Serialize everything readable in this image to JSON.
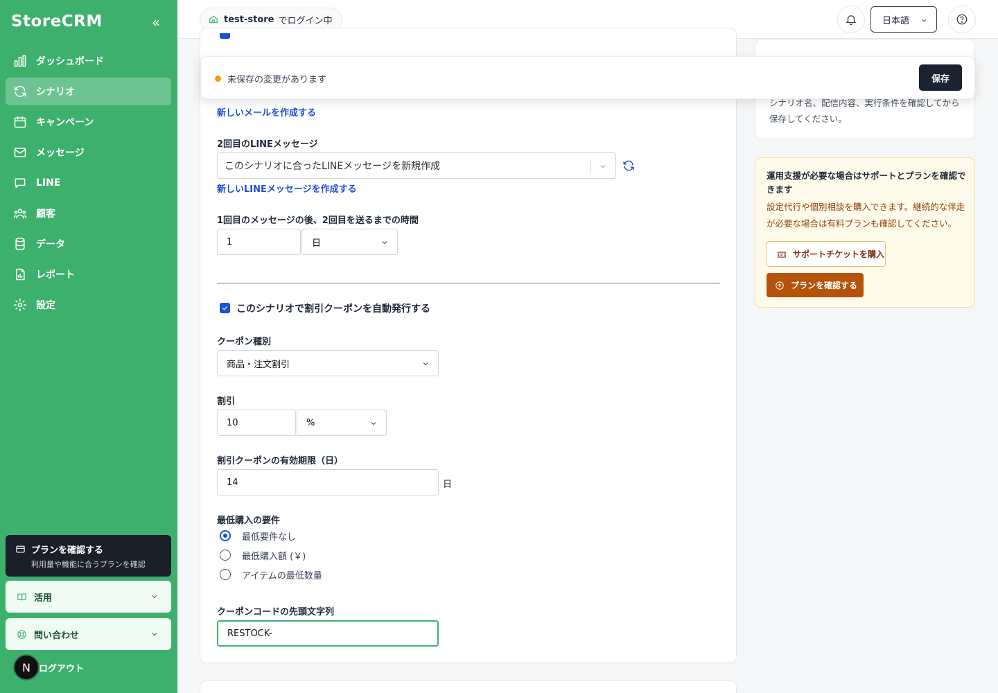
{
  "app": {
    "logo": "StoreCRM"
  },
  "sidebar": {
    "items": [
      {
        "label": "ダッシュボード",
        "icon": "chart-bar-icon"
      },
      {
        "label": "シナリオ",
        "icon": "refresh-cycle-icon",
        "active": true
      },
      {
        "label": "キャンペーン",
        "icon": "calendar-icon"
      },
      {
        "label": "メッセージ",
        "icon": "mail-icon"
      },
      {
        "label": "LINE",
        "icon": "chat-bubble-icon"
      },
      {
        "label": "顧客",
        "icon": "users-icon"
      },
      {
        "label": "データ",
        "icon": "database-icon"
      },
      {
        "label": "レポート",
        "icon": "report-file-icon"
      },
      {
        "label": "設定",
        "icon": "gear-icon"
      }
    ],
    "plan_card": {
      "title": "プランを確認する",
      "subtitle": "利用量や機能に合うプランを確認"
    },
    "usage": "活用",
    "contact": "問い合わせ",
    "logout": "ログアウト",
    "avatar_letter": "N"
  },
  "header": {
    "store_name": "test-store",
    "store_suffix": "でログイン中",
    "language": "日本語"
  },
  "unsaved_bar": {
    "message": "未保存の変更があります",
    "save_label": "保存"
  },
  "form": {
    "new_email_link": "新しいメールを作成する",
    "line2_label": "2回目のLINEメッセージ",
    "line2_value": "このシナリオに合ったLINEメッセージを新規作成",
    "new_line_link": "新しいLINEメッセージを作成する",
    "interval_label": "1回目のメッセージの後、2回目を送るまでの時間",
    "interval_value": "1",
    "interval_unit": "日",
    "coupon_checkbox_label": "このシナリオで割引クーポンを自動発行する",
    "coupon_type_label": "クーポン種別",
    "coupon_type_value": "商品・注文割引",
    "discount_label": "割引",
    "discount_value": "10",
    "discount_unit": "%",
    "expiry_label": "割引クーポンの有効期限（日）",
    "expiry_value": "14",
    "expiry_unit": "日",
    "min_req_label": "最低購入の要件",
    "min_req_options": [
      "最低要件なし",
      "最低購入額 (￥)",
      "アイテムの最低数量"
    ],
    "prefix_label": "クーポンコードの先頭文字列",
    "prefix_value": "RESTOCK-"
  },
  "right": {
    "card1_text": "シナリオ名、配信内容、実行条件を確認してから保存してください。",
    "support_heading": "運用支援が必要な場合はサポートとプランを確認できます",
    "support_text": "設定代行や個別相談を購入できます。継続的な伴走が必要な場合は有料プランも確認してください。",
    "ticket_label": "サポートチケットを購入",
    "plan_label": "プランを確認する"
  },
  "colors": {
    "sidebar": "#3db06e",
    "accent": "#1d4ed8",
    "warn": "#b45309"
  }
}
